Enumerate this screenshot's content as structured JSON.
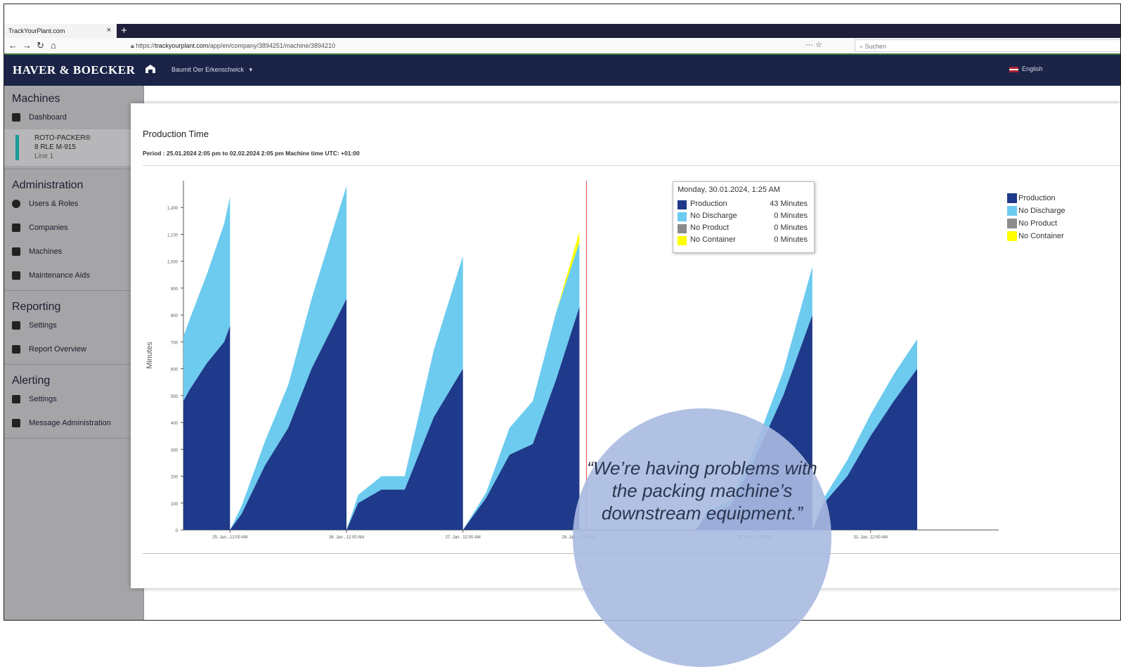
{
  "browser": {
    "tab_title": "TrackYourPlant.com",
    "tab_close": "×",
    "new_tab": "+",
    "url_prefix": "https://",
    "url_host": "trackyourplant.com",
    "url_path": "/app/en/company/3894251/machine/3894210",
    "url_icons": "··· ☆",
    "search_placeholder": "Suchen"
  },
  "app": {
    "brand": "HAVER & BOECKER",
    "company": "Baumit Oer Erkenschwick",
    "company_caret": "▾",
    "language": "English"
  },
  "sidebar": {
    "machines_heading": "Machines",
    "dashboard": "Dashboard",
    "machine_name": "ROTO-PACKER®",
    "machine_model": "8 RLE M-915",
    "machine_line": "Line 1",
    "administration_heading": "Administration",
    "users_roles": "Users & Roles",
    "companies": "Companies",
    "machines": "Machines",
    "maintenance_aids": "Maintenance Aids",
    "reporting_heading": "Reporting",
    "reporting_settings": "Settings",
    "report_overview": "Report Overview",
    "alerting_heading": "Alerting",
    "alerting_settings": "Settings",
    "message_administration": "Message Administration"
  },
  "modal": {
    "title": "Production Time",
    "period": "Period : 25.01.2024 2:05 pm to 02.02.2024 2:05 pm Machine time UTC: +01:00"
  },
  "tooltip": {
    "header": "Monday, 30.01.2024, 1:25 AM",
    "rows": [
      {
        "label": "Production",
        "value": "43 Minutes",
        "color": "#1f3a8a"
      },
      {
        "label": "No Discharge",
        "value": "0 Minutes",
        "color": "#6ccbef"
      },
      {
        "label": "No Product",
        "value": "0 Minutes",
        "color": "#8c8c8c"
      },
      {
        "label": "No Container",
        "value": "0 Minutes",
        "color": "#ffff00"
      }
    ]
  },
  "legend": [
    {
      "label": "Production",
      "color": "#1f3a8a"
    },
    {
      "label": "No Discharge",
      "color": "#6ccbef"
    },
    {
      "label": "No Product",
      "color": "#8c8c8c"
    },
    {
      "label": "No Container",
      "color": "#ffff00"
    }
  ],
  "quote": {
    "text": "“We’re having problems with the packing machine’s downstream equipment.”"
  },
  "chart_data": {
    "type": "area",
    "title": "",
    "ylabel": "Minutes",
    "ylim": [
      0,
      1300
    ],
    "yticks": [
      0,
      100,
      200,
      300,
      400,
      500,
      600,
      700,
      800,
      900,
      "1,000",
      "1,100",
      "1,200"
    ],
    "xticks": [
      "25. Jan , 12:00 AM",
      "26. Jan , 12:00 AM",
      "27. Jan , 12:00 AM",
      "28. Jan , 12:00 AM",
      "30. Jan, 12:00 AM",
      "31. Jan, 12:00 AM"
    ],
    "xlim": [
      -0.4,
      6.6
    ],
    "cursor_x": 3.06,
    "series_colors": {
      "Production": "#1f3a8a",
      "No Discharge": "#6ccbef",
      "No Container": "#ffff00"
    },
    "cycles": [
      {
        "x": [
          -0.4,
          -0.35,
          -0.2,
          -0.05,
          0.0
        ],
        "production": [
          480,
          520,
          620,
          700,
          760
        ],
        "no_discharge": [
          240,
          260,
          330,
          440,
          480
        ],
        "no_container": [
          0,
          0,
          0,
          0,
          0
        ]
      },
      {
        "x": [
          0.0,
          0.1,
          0.3,
          0.5,
          0.7,
          1.0
        ],
        "production": [
          0,
          60,
          240,
          380,
          600,
          860
        ],
        "no_discharge": [
          0,
          30,
          90,
          160,
          260,
          420
        ],
        "no_container": [
          0,
          0,
          0,
          0,
          0,
          0
        ]
      },
      {
        "x": [
          1.0,
          1.1,
          1.3,
          1.5,
          1.75,
          2.0
        ],
        "production": [
          0,
          100,
          150,
          150,
          420,
          600
        ],
        "no_discharge": [
          0,
          30,
          50,
          50,
          250,
          420
        ],
        "no_container": [
          0,
          0,
          0,
          0,
          0,
          0
        ]
      },
      {
        "x": [
          2.0,
          2.2,
          2.4,
          2.6,
          2.8,
          3.0
        ],
        "production": [
          0,
          120,
          280,
          320,
          560,
          830
        ],
        "no_discharge": [
          0,
          20,
          100,
          160,
          250,
          240
        ],
        "no_container": [
          0,
          0,
          0,
          0,
          0,
          40
        ]
      },
      {
        "x": [
          3.0,
          3.2,
          3.5,
          3.8,
          4.0
        ],
        "production": [
          0,
          0,
          0,
          0,
          0
        ],
        "no_discharge": [
          0,
          0,
          0,
          0,
          0
        ],
        "no_container": [
          0,
          0,
          0,
          0,
          0
        ]
      },
      {
        "x": [
          4.0,
          4.1,
          4.3,
          4.5,
          4.75,
          5.0
        ],
        "production": [
          0,
          60,
          90,
          260,
          500,
          800
        ],
        "no_discharge": [
          0,
          10,
          20,
          40,
          90,
          180
        ],
        "no_container": [
          0,
          0,
          0,
          0,
          0,
          0
        ]
      },
      {
        "x": [
          5.0,
          5.1,
          5.3,
          5.5,
          5.7,
          5.9
        ],
        "production": [
          0,
          100,
          200,
          350,
          480,
          600
        ],
        "no_discharge": [
          0,
          20,
          60,
          80,
          100,
          110
        ],
        "no_container": [
          0,
          0,
          0,
          0,
          0,
          0
        ]
      }
    ]
  }
}
